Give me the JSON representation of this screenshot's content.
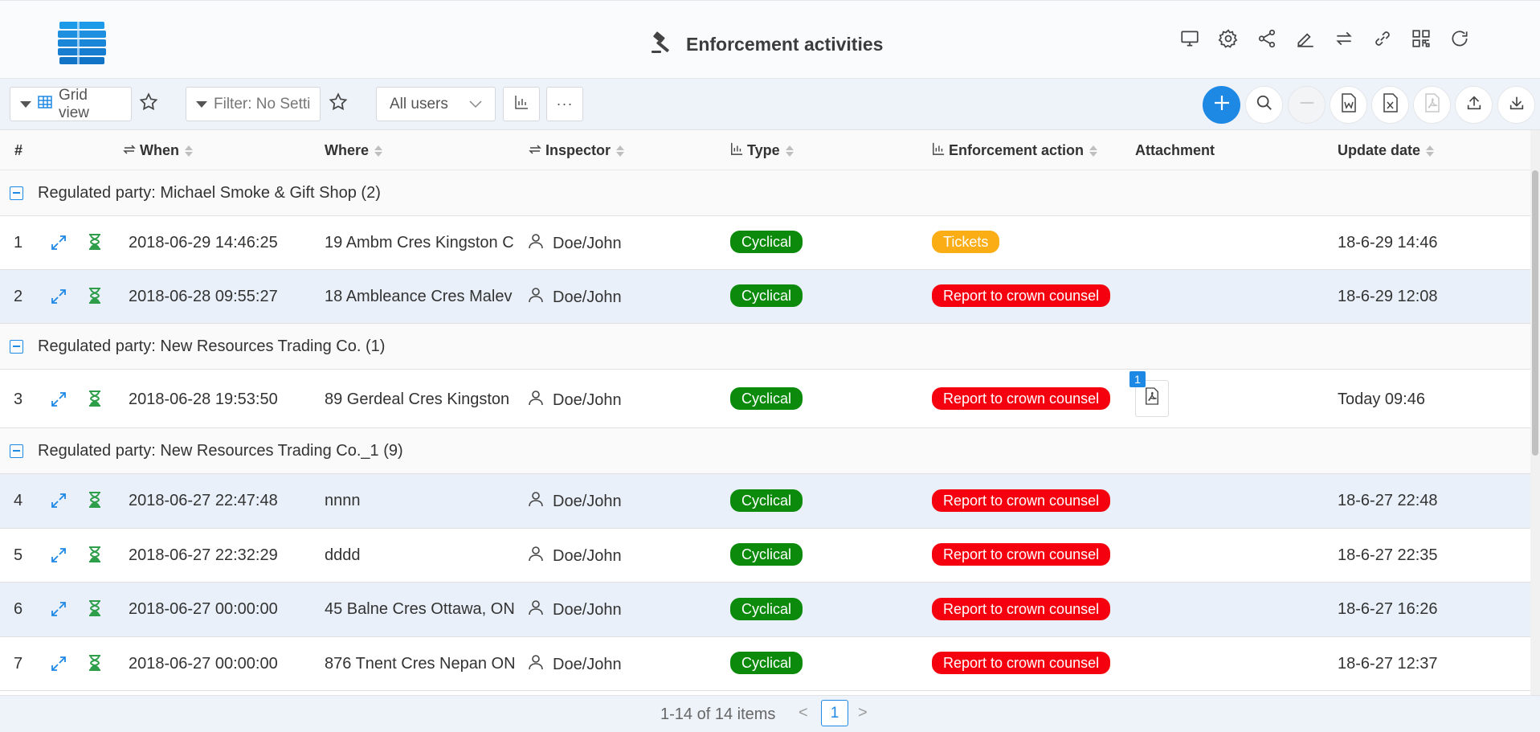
{
  "header": {
    "title": "Enforcement activities",
    "icons": [
      "monitor-icon",
      "gear-icon",
      "share-icon",
      "edit-icon",
      "swap-icon",
      "link-icon",
      "qr-code-icon",
      "refresh-icon"
    ]
  },
  "toolbar": {
    "view_label": "Grid view",
    "filter_label": "Filter: No Setti",
    "users_select": "All users",
    "more_label": "···"
  },
  "table": {
    "columns": {
      "num": "#",
      "when": "When",
      "where": "Where",
      "inspector": "Inspector",
      "type": "Type",
      "action": "Enforcement action",
      "attachment": "Attachment",
      "update": "Update date"
    },
    "groups": [
      {
        "label": "Regulated party: Michael Smoke & Gift Shop (2)"
      },
      {
        "label": "Regulated party: New Resources Trading Co. (1)"
      },
      {
        "label": "Regulated party: New Resources Trading Co._1 (9)"
      }
    ],
    "rows": [
      {
        "num": "1",
        "when": "2018-06-29 14:46:25",
        "where": "19 Ambm Cres Kingston C",
        "inspector": "Doe/John",
        "type": "Cyclical",
        "action": "Tickets",
        "action_color": "#faad14",
        "attachment_count": "",
        "update": "18-6-29 14:46"
      },
      {
        "num": "2",
        "when": "2018-06-28 09:55:27",
        "where": "18 Ambleance Cres Malev",
        "inspector": "Doe/John",
        "type": "Cyclical",
        "action": "Report to crown counsel",
        "action_color": "#f5000f",
        "attachment_count": "",
        "update": "18-6-29 12:08"
      },
      {
        "num": "3",
        "when": "2018-06-28 19:53:50",
        "where": "89 Gerdeal Cres Kingston",
        "inspector": "Doe/John",
        "type": "Cyclical",
        "action": "Report to crown counsel",
        "action_color": "#f5000f",
        "attachment_count": "1",
        "update": "Today 09:46"
      },
      {
        "num": "4",
        "when": "2018-06-27 22:47:48",
        "where": "nnnn",
        "inspector": "Doe/John",
        "type": "Cyclical",
        "action": "Report to crown counsel",
        "action_color": "#f5000f",
        "attachment_count": "",
        "update": "18-6-27 22:48"
      },
      {
        "num": "5",
        "when": "2018-06-27 22:32:29",
        "where": "dddd",
        "inspector": "Doe/John",
        "type": "Cyclical",
        "action": "Report to crown counsel",
        "action_color": "#f5000f",
        "attachment_count": "",
        "update": "18-6-27 22:35"
      },
      {
        "num": "6",
        "when": "2018-06-27 00:00:00",
        "where": "45 Balne Cres Ottawa, ON",
        "inspector": "Doe/John",
        "type": "Cyclical",
        "action": "Report to crown counsel",
        "action_color": "#f5000f",
        "attachment_count": "",
        "update": "18-6-27 16:26"
      },
      {
        "num": "7",
        "when": "2018-06-27 00:00:00",
        "where": "876 Tnent Cres Nepan ON",
        "inspector": "Doe/John",
        "type": "Cyclical",
        "action": "Report to crown counsel",
        "action_color": "#f5000f",
        "attachment_count": "",
        "update": "18-6-27 12:37"
      }
    ],
    "type_color": "#0b8a0b"
  },
  "pagination": {
    "total_label": "1-14 of 14 items",
    "current_page": "1",
    "prev": "<",
    "next": ">"
  }
}
